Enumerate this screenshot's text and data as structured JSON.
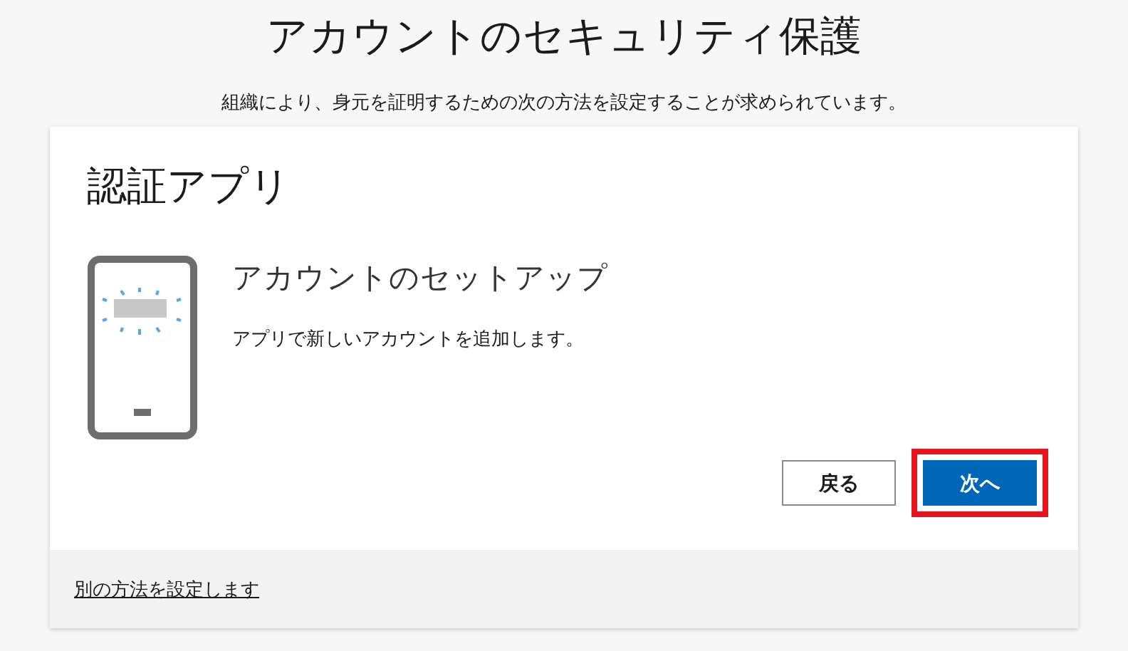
{
  "page": {
    "title": "アカウントのセキュリティ保護",
    "subtitle": "組織により、身元を証明するための次の方法を設定することが求められています。"
  },
  "card": {
    "title": "認証アプリ",
    "heading": "アカウントのセットアップ",
    "description": "アプリで新しいアカウントを追加します。",
    "buttons": [
      {
        "label": "戻る",
        "kind": "secondary",
        "highlighted": false
      },
      {
        "label": "次へ",
        "kind": "primary",
        "highlighted": true
      }
    ],
    "footer_link": "別の方法を設定します"
  }
}
